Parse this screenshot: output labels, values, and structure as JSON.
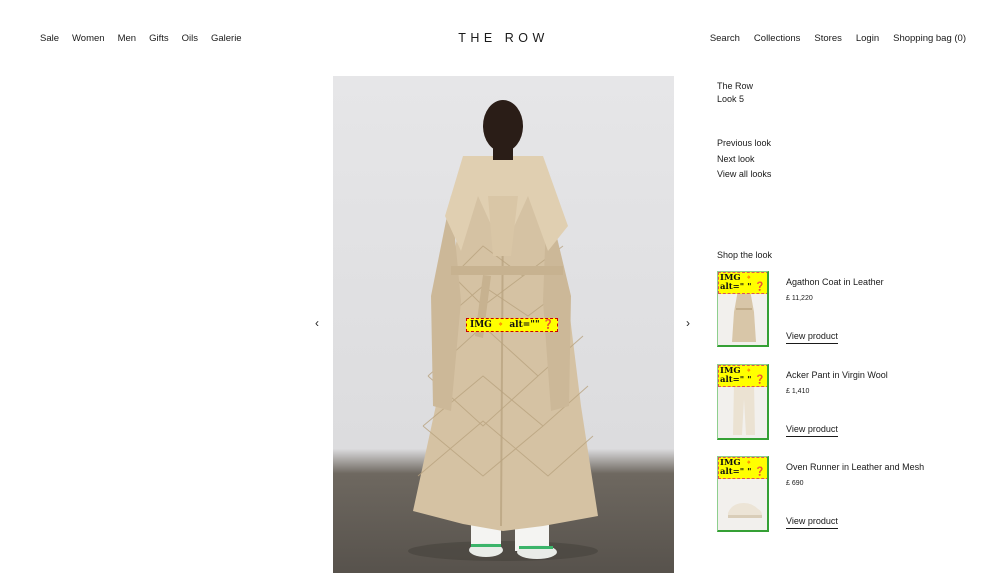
{
  "header": {
    "brand": "THE ROW",
    "nav_left": [
      "Sale",
      "Women",
      "Men",
      "Gifts",
      "Oils",
      "Galerie"
    ],
    "nav_right": [
      "Search",
      "Collections",
      "Stores",
      "Login",
      "Shopping bag (0)"
    ]
  },
  "hero": {
    "img_badge": "IMG 🔸 alt=\"\" ❓",
    "prev_arrow": "‹",
    "next_arrow": "›"
  },
  "look_info": {
    "collection": "The Row",
    "look_number": "Look 5",
    "previous": "Previous look",
    "next": "Next look",
    "view_all": "View all looks"
  },
  "shop": {
    "title": "Shop the look",
    "products": [
      {
        "img_badge": "IMG 🔸 alt=\" \" ❓",
        "name": "Agathon Coat in Leather",
        "price": "£ 11,220",
        "link": "View product"
      },
      {
        "img_badge": "IMG 🔸 alt=\" \" ❓",
        "name": "Acker Pant in Virgin Wool",
        "price": "£ 1,410",
        "link": "View product"
      },
      {
        "img_badge": "IMG 🔸 alt=\" \" ❓",
        "name": "Oven Runner in Leather and Mesh",
        "price": "£ 690",
        "link": "View product"
      }
    ]
  },
  "colors": {
    "text": "#1a1a1a",
    "badge_bg": "#ffff00",
    "thumb_border": "#35a035"
  }
}
